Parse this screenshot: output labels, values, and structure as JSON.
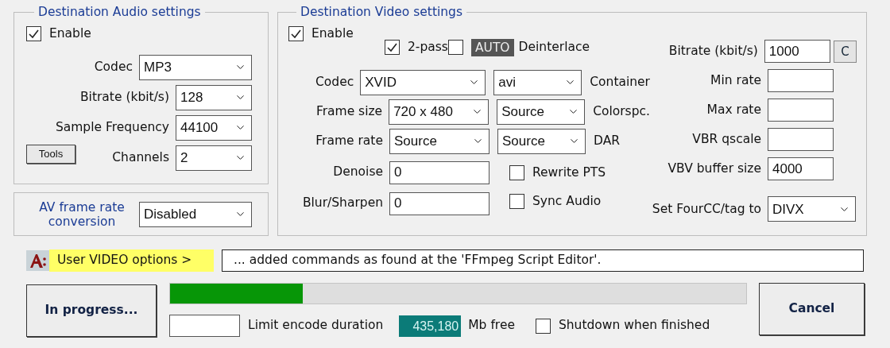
{
  "audio": {
    "title": "Destination Audio settings",
    "enable": {
      "label": "Enable",
      "checked": true
    },
    "fields": [
      {
        "label": "Codec",
        "value": "MP3"
      },
      {
        "label": "Bitrate (kbit/s)",
        "value": "128"
      },
      {
        "label": "Sample Frequency",
        "value": "44100"
      },
      {
        "label": "Channels",
        "value": "2"
      }
    ],
    "tools_button": "Tools"
  },
  "av_conversion": {
    "label": "AV frame rate conversion",
    "value": "Disabled"
  },
  "video": {
    "title": "Destination Video settings",
    "enable": {
      "label": "Enable",
      "checked": true
    },
    "two_pass": {
      "label": "2-pass",
      "checked": true
    },
    "deinterlace": {
      "badge": "AUTO",
      "label": "Deinterlace",
      "checked": false
    },
    "selects": [
      {
        "label": "Codec",
        "value": "XVID",
        "option": "avi",
        "option_label": "Container"
      },
      {
        "label": "Frame size",
        "value": "720 x 480",
        "option": "Source",
        "option_label": "Colorspc."
      },
      {
        "label": "Frame rate",
        "value": "Source",
        "option": "Source",
        "option_label": "DAR"
      }
    ],
    "filters": [
      {
        "label": "Denoise",
        "value": "0"
      },
      {
        "label": "Blur/Sharpen",
        "value": "0"
      }
    ],
    "flags": [
      {
        "label": "Rewrite PTS",
        "checked": false
      },
      {
        "label": "Sync Audio",
        "checked": false
      }
    ],
    "rates": [
      {
        "kind": "input",
        "label": "Bitrate (kbit/s)",
        "value": "1000",
        "button": "C"
      },
      {
        "kind": "input",
        "label": "Min rate"
      },
      {
        "kind": "input",
        "label": "Max rate"
      },
      {
        "kind": "input",
        "label": "VBR qscale"
      },
      {
        "kind": "input",
        "label": "VBV buffer size",
        "value": "4000"
      },
      {
        "kind": "select",
        "label": "Set FourCC/tag to",
        "value": "DIVX"
      }
    ]
  },
  "user_options": {
    "label": "User VIDEO options >",
    "text": "... added commands as found at the 'FFmpeg Script Editor'."
  },
  "encode": {
    "status_button": "In progress...",
    "level": 0.23,
    "limit_label": "Limit encode duration",
    "free_space": "435,180",
    "free_label": "Mb free",
    "shutdown": {
      "label": "Shutdown when finished",
      "checked": false
    },
    "cancel_button": "Cancel"
  }
}
